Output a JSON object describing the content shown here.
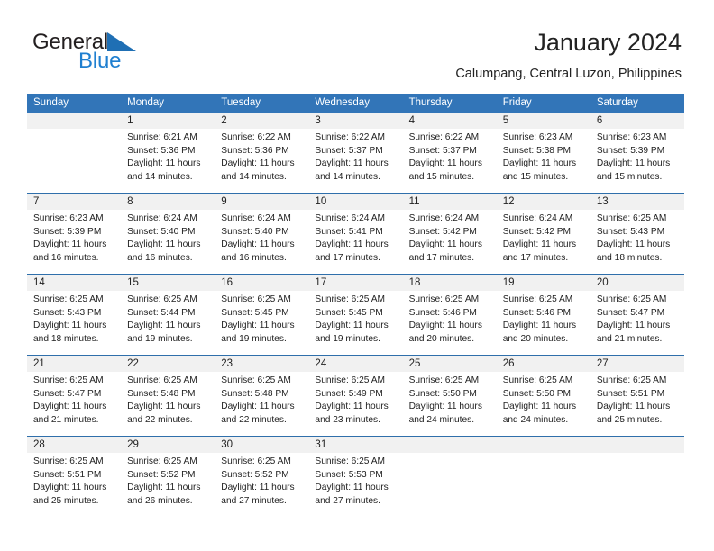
{
  "brand": {
    "name_part1": "General",
    "name_part2": "Blue",
    "triangle_color": "#1f6fb4",
    "text_color": "#231f20",
    "blue_color": "#1f7fd0"
  },
  "header": {
    "title": "January 2024",
    "subtitle": "Calumpang, Central Luzon, Philippines"
  },
  "theme": {
    "header_blue": "#3275b8",
    "rule_blue": "#2f6fab",
    "date_band_gray": "#f1f1f1"
  },
  "weekdays": [
    "Sunday",
    "Monday",
    "Tuesday",
    "Wednesday",
    "Thursday",
    "Friday",
    "Saturday"
  ],
  "weeks": [
    {
      "days": [
        {
          "num": "",
          "sunrise": "",
          "sunset": "",
          "daylight_1": "",
          "daylight_2": "",
          "empty": true
        },
        {
          "num": "1",
          "sunrise": "Sunrise: 6:21 AM",
          "sunset": "Sunset: 5:36 PM",
          "daylight_1": "Daylight: 11 hours",
          "daylight_2": "and 14 minutes."
        },
        {
          "num": "2",
          "sunrise": "Sunrise: 6:22 AM",
          "sunset": "Sunset: 5:36 PM",
          "daylight_1": "Daylight: 11 hours",
          "daylight_2": "and 14 minutes."
        },
        {
          "num": "3",
          "sunrise": "Sunrise: 6:22 AM",
          "sunset": "Sunset: 5:37 PM",
          "daylight_1": "Daylight: 11 hours",
          "daylight_2": "and 14 minutes."
        },
        {
          "num": "4",
          "sunrise": "Sunrise: 6:22 AM",
          "sunset": "Sunset: 5:37 PM",
          "daylight_1": "Daylight: 11 hours",
          "daylight_2": "and 15 minutes."
        },
        {
          "num": "5",
          "sunrise": "Sunrise: 6:23 AM",
          "sunset": "Sunset: 5:38 PM",
          "daylight_1": "Daylight: 11 hours",
          "daylight_2": "and 15 minutes."
        },
        {
          "num": "6",
          "sunrise": "Sunrise: 6:23 AM",
          "sunset": "Sunset: 5:39 PM",
          "daylight_1": "Daylight: 11 hours",
          "daylight_2": "and 15 minutes."
        }
      ]
    },
    {
      "days": [
        {
          "num": "7",
          "sunrise": "Sunrise: 6:23 AM",
          "sunset": "Sunset: 5:39 PM",
          "daylight_1": "Daylight: 11 hours",
          "daylight_2": "and 16 minutes."
        },
        {
          "num": "8",
          "sunrise": "Sunrise: 6:24 AM",
          "sunset": "Sunset: 5:40 PM",
          "daylight_1": "Daylight: 11 hours",
          "daylight_2": "and 16 minutes."
        },
        {
          "num": "9",
          "sunrise": "Sunrise: 6:24 AM",
          "sunset": "Sunset: 5:40 PM",
          "daylight_1": "Daylight: 11 hours",
          "daylight_2": "and 16 minutes."
        },
        {
          "num": "10",
          "sunrise": "Sunrise: 6:24 AM",
          "sunset": "Sunset: 5:41 PM",
          "daylight_1": "Daylight: 11 hours",
          "daylight_2": "and 17 minutes."
        },
        {
          "num": "11",
          "sunrise": "Sunrise: 6:24 AM",
          "sunset": "Sunset: 5:42 PM",
          "daylight_1": "Daylight: 11 hours",
          "daylight_2": "and 17 minutes."
        },
        {
          "num": "12",
          "sunrise": "Sunrise: 6:24 AM",
          "sunset": "Sunset: 5:42 PM",
          "daylight_1": "Daylight: 11 hours",
          "daylight_2": "and 17 minutes."
        },
        {
          "num": "13",
          "sunrise": "Sunrise: 6:25 AM",
          "sunset": "Sunset: 5:43 PM",
          "daylight_1": "Daylight: 11 hours",
          "daylight_2": "and 18 minutes."
        }
      ]
    },
    {
      "days": [
        {
          "num": "14",
          "sunrise": "Sunrise: 6:25 AM",
          "sunset": "Sunset: 5:43 PM",
          "daylight_1": "Daylight: 11 hours",
          "daylight_2": "and 18 minutes."
        },
        {
          "num": "15",
          "sunrise": "Sunrise: 6:25 AM",
          "sunset": "Sunset: 5:44 PM",
          "daylight_1": "Daylight: 11 hours",
          "daylight_2": "and 19 minutes."
        },
        {
          "num": "16",
          "sunrise": "Sunrise: 6:25 AM",
          "sunset": "Sunset: 5:45 PM",
          "daylight_1": "Daylight: 11 hours",
          "daylight_2": "and 19 minutes."
        },
        {
          "num": "17",
          "sunrise": "Sunrise: 6:25 AM",
          "sunset": "Sunset: 5:45 PM",
          "daylight_1": "Daylight: 11 hours",
          "daylight_2": "and 19 minutes."
        },
        {
          "num": "18",
          "sunrise": "Sunrise: 6:25 AM",
          "sunset": "Sunset: 5:46 PM",
          "daylight_1": "Daylight: 11 hours",
          "daylight_2": "and 20 minutes."
        },
        {
          "num": "19",
          "sunrise": "Sunrise: 6:25 AM",
          "sunset": "Sunset: 5:46 PM",
          "daylight_1": "Daylight: 11 hours",
          "daylight_2": "and 20 minutes."
        },
        {
          "num": "20",
          "sunrise": "Sunrise: 6:25 AM",
          "sunset": "Sunset: 5:47 PM",
          "daylight_1": "Daylight: 11 hours",
          "daylight_2": "and 21 minutes."
        }
      ]
    },
    {
      "days": [
        {
          "num": "21",
          "sunrise": "Sunrise: 6:25 AM",
          "sunset": "Sunset: 5:47 PM",
          "daylight_1": "Daylight: 11 hours",
          "daylight_2": "and 21 minutes."
        },
        {
          "num": "22",
          "sunrise": "Sunrise: 6:25 AM",
          "sunset": "Sunset: 5:48 PM",
          "daylight_1": "Daylight: 11 hours",
          "daylight_2": "and 22 minutes."
        },
        {
          "num": "23",
          "sunrise": "Sunrise: 6:25 AM",
          "sunset": "Sunset: 5:48 PM",
          "daylight_1": "Daylight: 11 hours",
          "daylight_2": "and 22 minutes."
        },
        {
          "num": "24",
          "sunrise": "Sunrise: 6:25 AM",
          "sunset": "Sunset: 5:49 PM",
          "daylight_1": "Daylight: 11 hours",
          "daylight_2": "and 23 minutes."
        },
        {
          "num": "25",
          "sunrise": "Sunrise: 6:25 AM",
          "sunset": "Sunset: 5:50 PM",
          "daylight_1": "Daylight: 11 hours",
          "daylight_2": "and 24 minutes."
        },
        {
          "num": "26",
          "sunrise": "Sunrise: 6:25 AM",
          "sunset": "Sunset: 5:50 PM",
          "daylight_1": "Daylight: 11 hours",
          "daylight_2": "and 24 minutes."
        },
        {
          "num": "27",
          "sunrise": "Sunrise: 6:25 AM",
          "sunset": "Sunset: 5:51 PM",
          "daylight_1": "Daylight: 11 hours",
          "daylight_2": "and 25 minutes."
        }
      ]
    },
    {
      "days": [
        {
          "num": "28",
          "sunrise": "Sunrise: 6:25 AM",
          "sunset": "Sunset: 5:51 PM",
          "daylight_1": "Daylight: 11 hours",
          "daylight_2": "and 25 minutes."
        },
        {
          "num": "29",
          "sunrise": "Sunrise: 6:25 AM",
          "sunset": "Sunset: 5:52 PM",
          "daylight_1": "Daylight: 11 hours",
          "daylight_2": "and 26 minutes."
        },
        {
          "num": "30",
          "sunrise": "Sunrise: 6:25 AM",
          "sunset": "Sunset: 5:52 PM",
          "daylight_1": "Daylight: 11 hours",
          "daylight_2": "and 27 minutes."
        },
        {
          "num": "31",
          "sunrise": "Sunrise: 6:25 AM",
          "sunset": "Sunset: 5:53 PM",
          "daylight_1": "Daylight: 11 hours",
          "daylight_2": "and 27 minutes."
        },
        {
          "num": "",
          "sunrise": "",
          "sunset": "",
          "daylight_1": "",
          "daylight_2": "",
          "empty": true
        },
        {
          "num": "",
          "sunrise": "",
          "sunset": "",
          "daylight_1": "",
          "daylight_2": "",
          "empty": true
        },
        {
          "num": "",
          "sunrise": "",
          "sunset": "",
          "daylight_1": "",
          "daylight_2": "",
          "empty": true
        }
      ]
    }
  ]
}
